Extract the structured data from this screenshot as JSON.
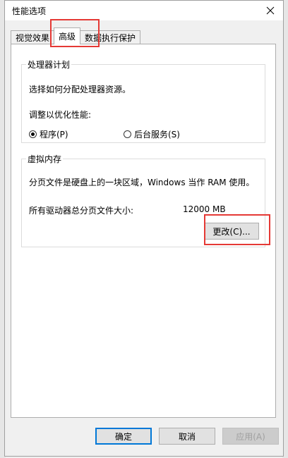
{
  "window": {
    "title": "性能选项"
  },
  "tabs": [
    {
      "label": "视觉效果"
    },
    {
      "label": "高级"
    },
    {
      "label": "数据执行保护"
    }
  ],
  "processor": {
    "group_title": "处理器计划",
    "description": "选择如何分配处理器资源。",
    "adjust_label": "调整以优化性能:",
    "options": [
      {
        "label": "程序(P)",
        "selected": true
      },
      {
        "label": "后台服务(S)",
        "selected": false
      }
    ]
  },
  "virtual_memory": {
    "group_title": "虚拟内存",
    "description": "分页文件是硬盘上的一块区域，Windows 当作 RAM 使用。",
    "total_label": "所有驱动器总分页文件大小:",
    "total_value": "12000 MB",
    "change_button": "更改(C)..."
  },
  "buttons": {
    "ok": "确定",
    "cancel": "取消",
    "apply": "应用(A)"
  },
  "colors": {
    "highlight": "#e53935",
    "default_button_border": "#0078d7"
  }
}
